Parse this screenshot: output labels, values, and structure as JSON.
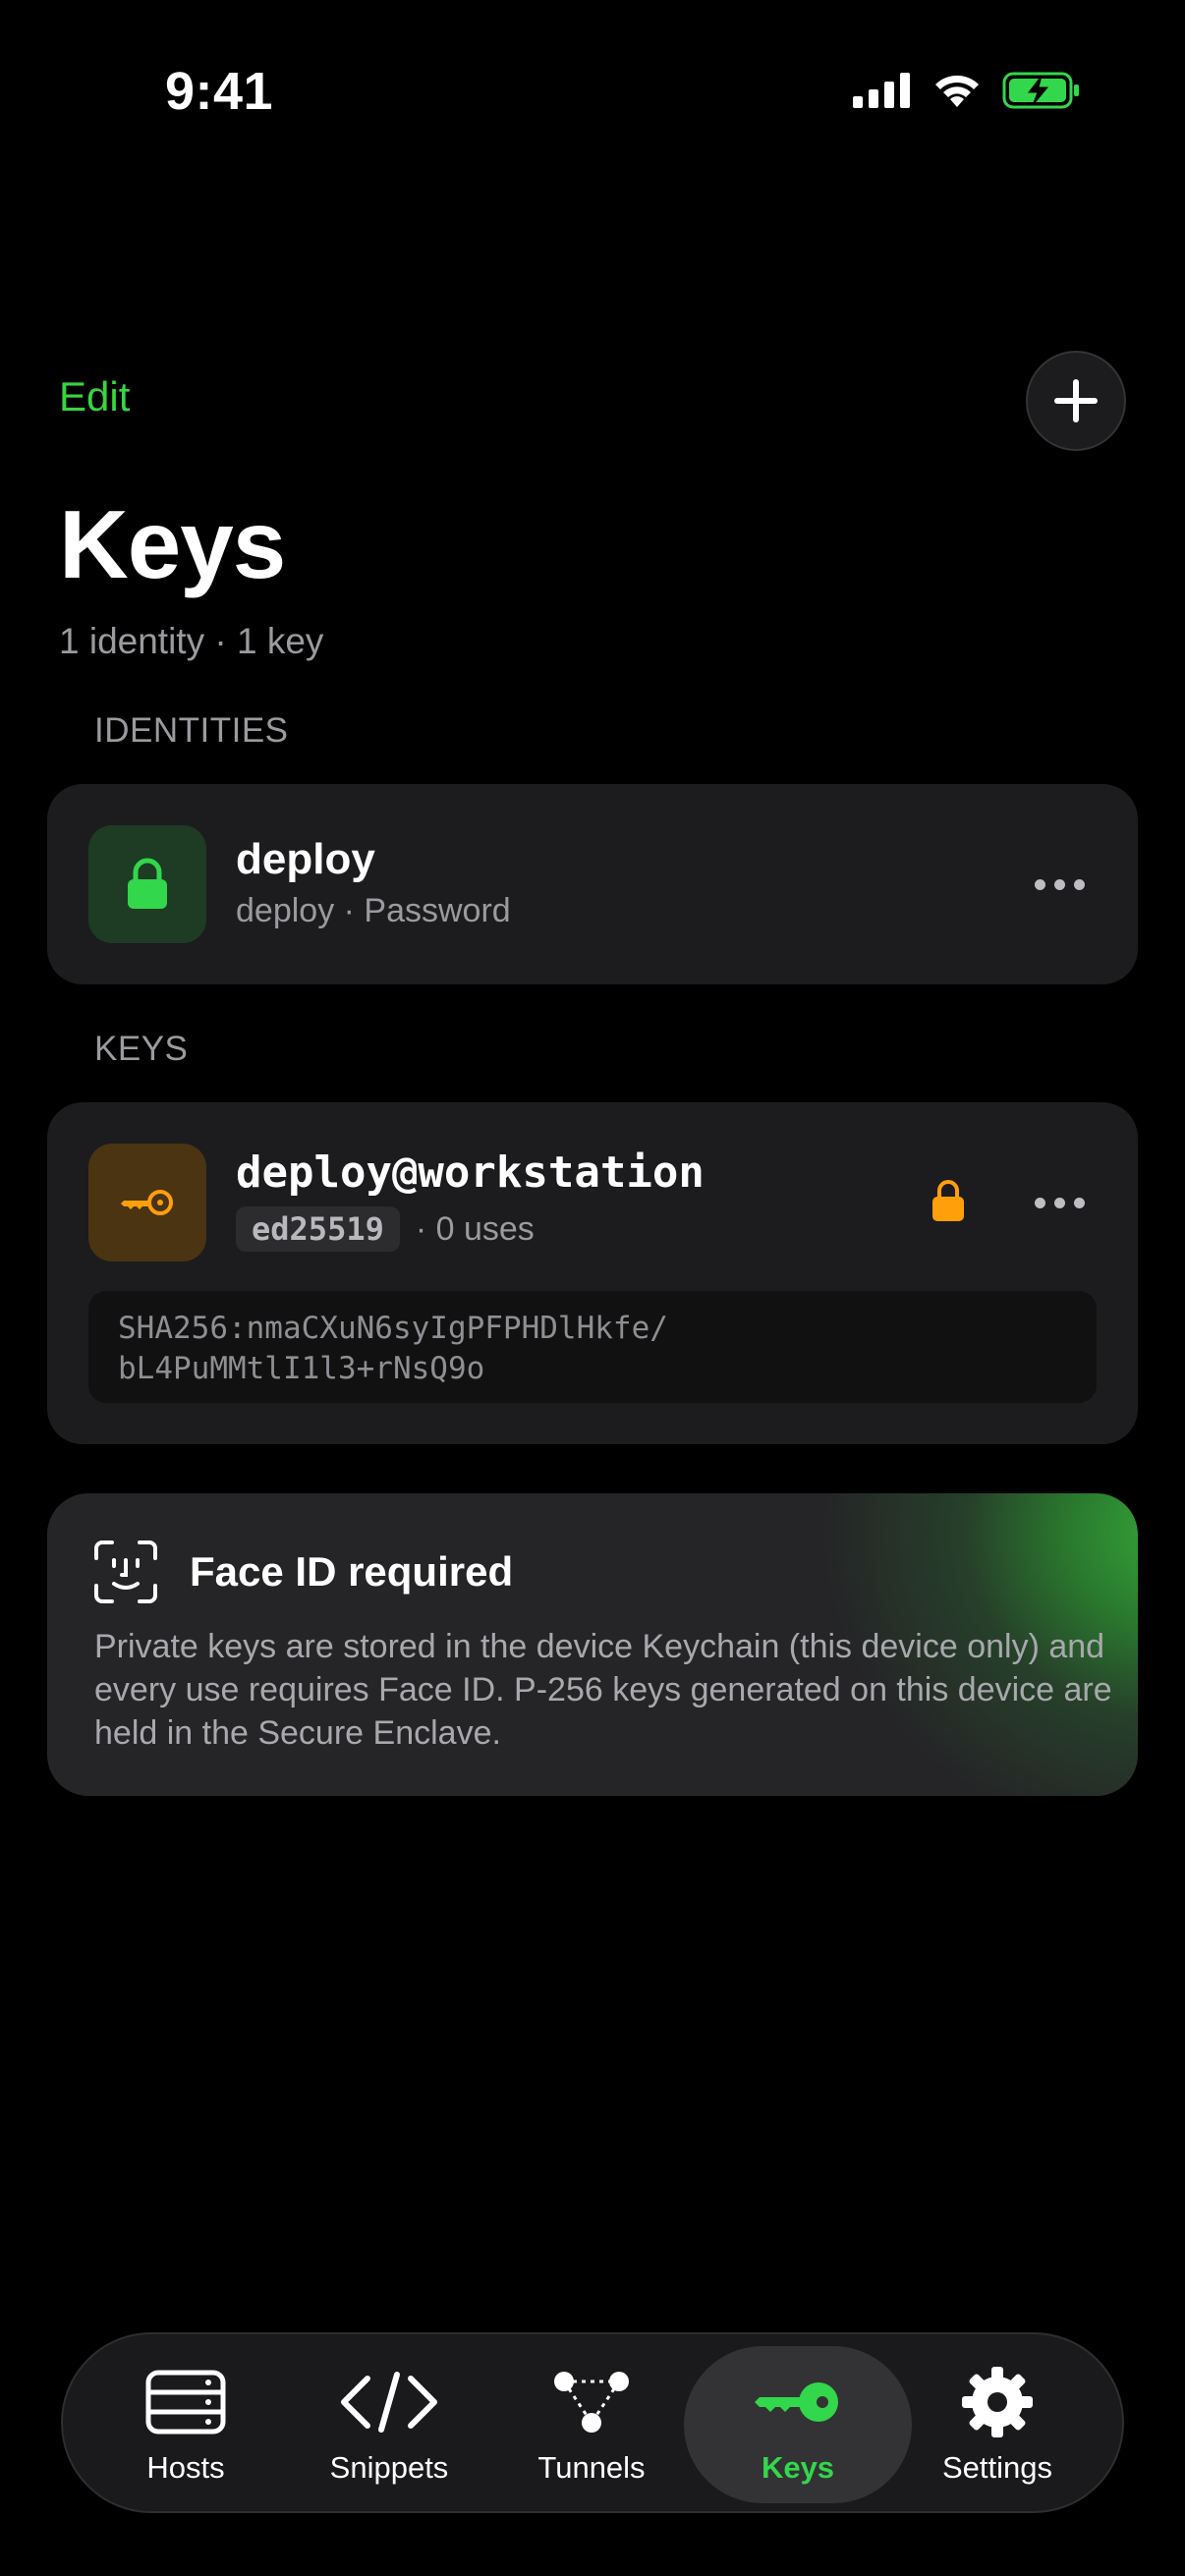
{
  "status_bar": {
    "time": "9:41"
  },
  "header": {
    "edit_label": "Edit",
    "add_icon": "plus-icon",
    "title": "Keys",
    "subtitle": "1 identity · 1 key"
  },
  "sections": {
    "identities_label": "IDENTITIES",
    "keys_label": "KEYS"
  },
  "identity": {
    "icon": "lock-icon",
    "name": "deploy",
    "detail": "deploy · Password"
  },
  "key": {
    "icon": "key-icon",
    "name": "deploy@workstation",
    "type_badge": "ed25519",
    "uses": "· 0 uses",
    "fingerprint_line1": "SHA256:nmaCXuN6syIgPFPHDlHkfe/",
    "fingerprint_line2": "bL4PuMMtlI1l3+rNsQ9o"
  },
  "faceid_notice": {
    "icon": "face-id-icon",
    "title": "Face ID required",
    "body": "Private keys are stored in the device Keychain (this device only) and every use requires Face ID. P-256 keys generated on this device are held in the Secure Enclave."
  },
  "tab_bar": {
    "tabs": [
      {
        "label": "Hosts",
        "icon": "server-icon"
      },
      {
        "label": "Snippets",
        "icon": "code-icon"
      },
      {
        "label": "Tunnels",
        "icon": "network-icon"
      },
      {
        "label": "Keys",
        "icon": "key-icon"
      },
      {
        "label": "Settings",
        "icon": "gear-icon"
      }
    ],
    "active": "Keys"
  },
  "colors": {
    "accent": "#32d74b",
    "warning": "#ff9f0a",
    "background": "#000000",
    "card": "#1c1c1e"
  }
}
